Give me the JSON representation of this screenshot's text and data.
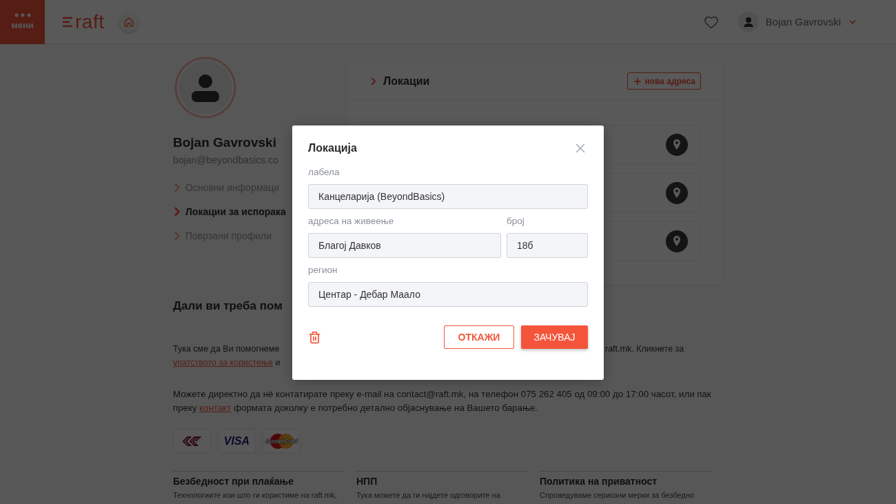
{
  "header": {
    "menu_label": "мени",
    "logo": "raft",
    "user_name": "Bojan Gavrovski"
  },
  "profile": {
    "name": "Bojan Gavrovski",
    "email": "bojan@beyondbasics.co",
    "nav": [
      {
        "label": "Основни информаци",
        "selected": false
      },
      {
        "label": "Локации за испорака",
        "selected": true
      },
      {
        "label": "Поврзани профили",
        "selected": false
      }
    ]
  },
  "locations_panel": {
    "title": "Локации",
    "new_button": "нова адреса",
    "cards": [
      {
        "kind": "pin"
      },
      {
        "kind": "pin"
      },
      {
        "kind": "pin"
      }
    ]
  },
  "help": {
    "title": "Дали ви треба пом",
    "line1_left": "Тука сме да Ви помогнеме",
    "line1_right": "raft.mk. Кликнете за",
    "line2_link": "упатството за користење",
    "line2_rest": "и",
    "contact": {
      "before": "Можете директно да нè контатирате преку e-mail на contact@raft.mk, на телефон 075 262 405 од 09:00 до 17:00 часот, или пак преку",
      "link": "контакт",
      "after": "формата доколку е потребно детално објаснување на Вашето барање."
    }
  },
  "payment_logos": [
    {
      "kind": "bank"
    },
    {
      "kind": "visa",
      "label": "VISA"
    },
    {
      "kind": "mastercard",
      "label": "MasterCard"
    }
  ],
  "footer": [
    {
      "title": "Безбедност при плаќање",
      "text": "Технологиите кои што ги користиме на raft.mk,"
    },
    {
      "title": "НПП",
      "text": "Тука можете да ги најдете одговорите на"
    },
    {
      "title": "Политика на приватност",
      "text": "Спроведуваме сериозни мерки за безбедно"
    }
  ],
  "dialog": {
    "title": "Локација",
    "rows": [
      [
        {
          "label": "лабела",
          "value": "Канцеларија (BeyondBasics)"
        }
      ],
      [
        {
          "label": "адреса на живеење",
          "value": "Благој Давков"
        },
        {
          "label": "број",
          "value": "18б"
        }
      ],
      [
        {
          "label": "регион",
          "value": "Центар - Дебар Маало"
        }
      ]
    ],
    "cancel": "ОТКАЖИ",
    "save": "ЗАЧУВАЈ"
  }
}
